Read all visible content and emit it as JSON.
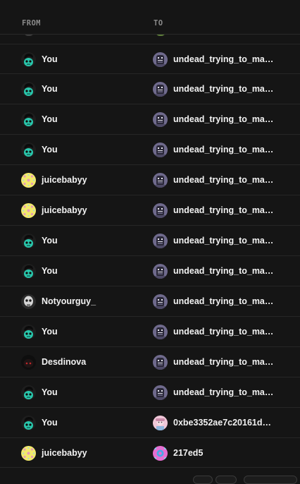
{
  "table": {
    "headers": {
      "from": "FROM",
      "to": "TO"
    },
    "rows": [
      {
        "from": {
          "name": "You",
          "avatar": "alien-green-avatar"
        },
        "to": {
          "name": "undead_trying_to_make_...",
          "avatar": "undead-robot-avatar"
        }
      },
      {
        "from": {
          "name": "You",
          "avatar": "alien-green-avatar"
        },
        "to": {
          "name": "undead_trying_to_make_...",
          "avatar": "undead-robot-avatar"
        }
      },
      {
        "from": {
          "name": "You",
          "avatar": "alien-green-avatar"
        },
        "to": {
          "name": "undead_trying_to_make_...",
          "avatar": "undead-robot-avatar"
        }
      },
      {
        "from": {
          "name": "You",
          "avatar": "alien-green-avatar"
        },
        "to": {
          "name": "undead_trying_to_make_...",
          "avatar": "undead-robot-avatar"
        }
      },
      {
        "from": {
          "name": "juicebabyy",
          "avatar": "yellow-flower-avatar"
        },
        "to": {
          "name": "undead_trying_to_make_...",
          "avatar": "undead-robot-avatar"
        }
      },
      {
        "from": {
          "name": "juicebabyy",
          "avatar": "yellow-flower-avatar"
        },
        "to": {
          "name": "undead_trying_to_make_...",
          "avatar": "undead-robot-avatar"
        }
      },
      {
        "from": {
          "name": "You",
          "avatar": "alien-green-avatar"
        },
        "to": {
          "name": "undead_trying_to_make_...",
          "avatar": "undead-robot-avatar"
        }
      },
      {
        "from": {
          "name": "You",
          "avatar": "alien-green-avatar"
        },
        "to": {
          "name": "undead_trying_to_make_...",
          "avatar": "undead-robot-avatar"
        }
      },
      {
        "from": {
          "name": "Notyourguy_",
          "avatar": "skull-grey-avatar"
        },
        "to": {
          "name": "undead_trying_to_make_...",
          "avatar": "undead-robot-avatar"
        }
      },
      {
        "from": {
          "name": "You",
          "avatar": "alien-green-avatar"
        },
        "to": {
          "name": "undead_trying_to_make_...",
          "avatar": "undead-robot-avatar"
        }
      },
      {
        "from": {
          "name": "Desdinova",
          "avatar": "dark-red-eyes-avatar"
        },
        "to": {
          "name": "undead_trying_to_make_...",
          "avatar": "undead-robot-avatar"
        }
      },
      {
        "from": {
          "name": "You",
          "avatar": "alien-green-avatar"
        },
        "to": {
          "name": "undead_trying_to_make_...",
          "avatar": "undead-robot-avatar"
        }
      },
      {
        "from": {
          "name": "You",
          "avatar": "alien-green-avatar"
        },
        "to": {
          "name": "0xbe3352ae7c20161d4f...",
          "avatar": "pink-character-avatar"
        }
      },
      {
        "from": {
          "name": "juicebabyy",
          "avatar": "yellow-flower-avatar"
        },
        "to": {
          "name": "217ed5",
          "avatar": "pink-blue-pattern-avatar"
        }
      }
    ]
  },
  "colors": {
    "background": "#151515",
    "divider": "#262626",
    "header_text": "#8a8a8a",
    "name_text": "#f2f2f2",
    "alien_green": "#29c7ac",
    "flower_yellow": "#f2ea6c",
    "undead_purple": "#6f6a8c"
  }
}
